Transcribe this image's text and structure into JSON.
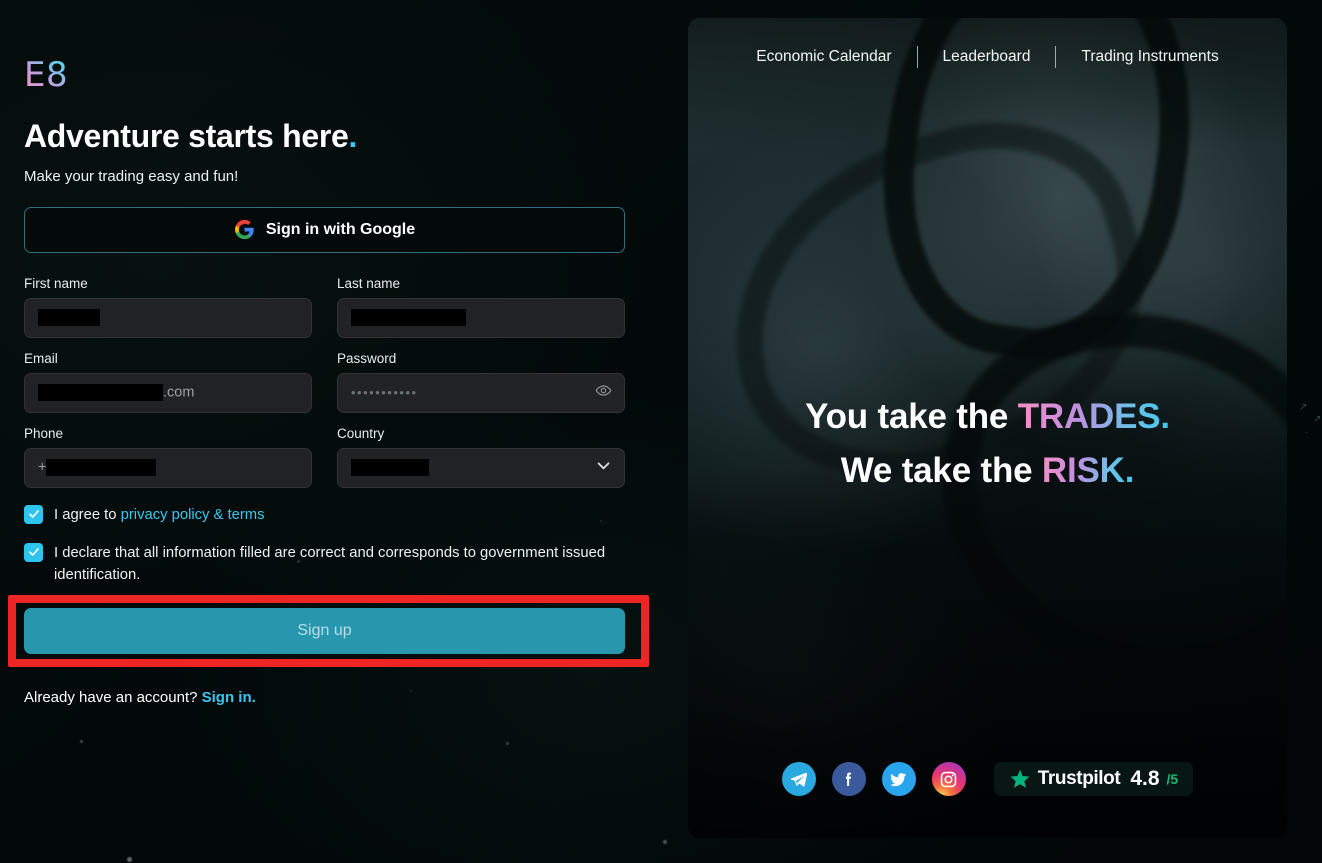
{
  "brand": {
    "logo_text": "E8",
    "logo_gradient_from": "#f49ac8",
    "logo_gradient_to": "#4fd0ef"
  },
  "colors": {
    "accent_cyan": "#3ac7ef",
    "checkbox_cyan": "#2ec4ee",
    "signup_teal": "#2897ae",
    "annotation_red": "#ee2525",
    "trustpilot_green": "#00b67a",
    "page_background": "#050a0a",
    "input_background": "#212224"
  },
  "left": {
    "headline": "Adventure starts here",
    "headline_period": ".",
    "subhead": "Make your trading easy and fun!",
    "google_button": {
      "label": "Sign in with Google",
      "icon": "google-g-icon"
    },
    "fields": [
      {
        "id": "first-name",
        "label": "First name",
        "value_redacted": true,
        "redact_width": 62,
        "prefix": "",
        "suffix": ""
      },
      {
        "id": "last-name",
        "label": "Last name",
        "value_redacted": true,
        "redact_width": 115,
        "prefix": "",
        "suffix": ""
      },
      {
        "id": "email",
        "label": "Email",
        "value_redacted": true,
        "redact_width": 125,
        "prefix": "",
        "suffix": ".com"
      },
      {
        "id": "password",
        "label": "Password",
        "value_masked": "•••••••••••",
        "icon": "eye-icon"
      },
      {
        "id": "phone",
        "label": "Phone",
        "value_redacted": true,
        "redact_width": 110,
        "prefix": "+",
        "suffix": ""
      },
      {
        "id": "country",
        "label": "Country",
        "value_redacted": true,
        "redact_width": 78,
        "icon": "chevron-down-icon"
      }
    ],
    "consents": [
      {
        "id": "privacy",
        "checked": true,
        "text_before": "I agree to ",
        "link_text": "privacy policy & terms",
        "text_after": ""
      },
      {
        "id": "declaration",
        "checked": true,
        "text_before": "I declare that all information filled are correct and corresponds to government issued identification.",
        "link_text": "",
        "text_after": ""
      }
    ],
    "signup_button": {
      "label": "Sign up",
      "highlighted": true
    },
    "footer": {
      "text": "Already have an account? ",
      "link_text": "Sign in."
    }
  },
  "hero": {
    "nav": [
      {
        "label": "Economic Calendar"
      },
      {
        "label": "Leaderboard"
      },
      {
        "label": "Trading Instruments"
      }
    ],
    "heading": {
      "line1_plain": "You take the ",
      "line1_accent": "TRADES.",
      "line2_plain": "We take the ",
      "line2_accent": "RISK."
    },
    "socials": [
      {
        "name": "telegram-icon",
        "label": "Telegram"
      },
      {
        "name": "facebook-icon",
        "label": "Facebook"
      },
      {
        "name": "twitter-icon",
        "label": "Twitter"
      },
      {
        "name": "instagram-icon",
        "label": "Instagram"
      }
    ],
    "trustpilot": {
      "name": "Trustpilot",
      "score": "4.8",
      "out_of": "/5"
    }
  }
}
